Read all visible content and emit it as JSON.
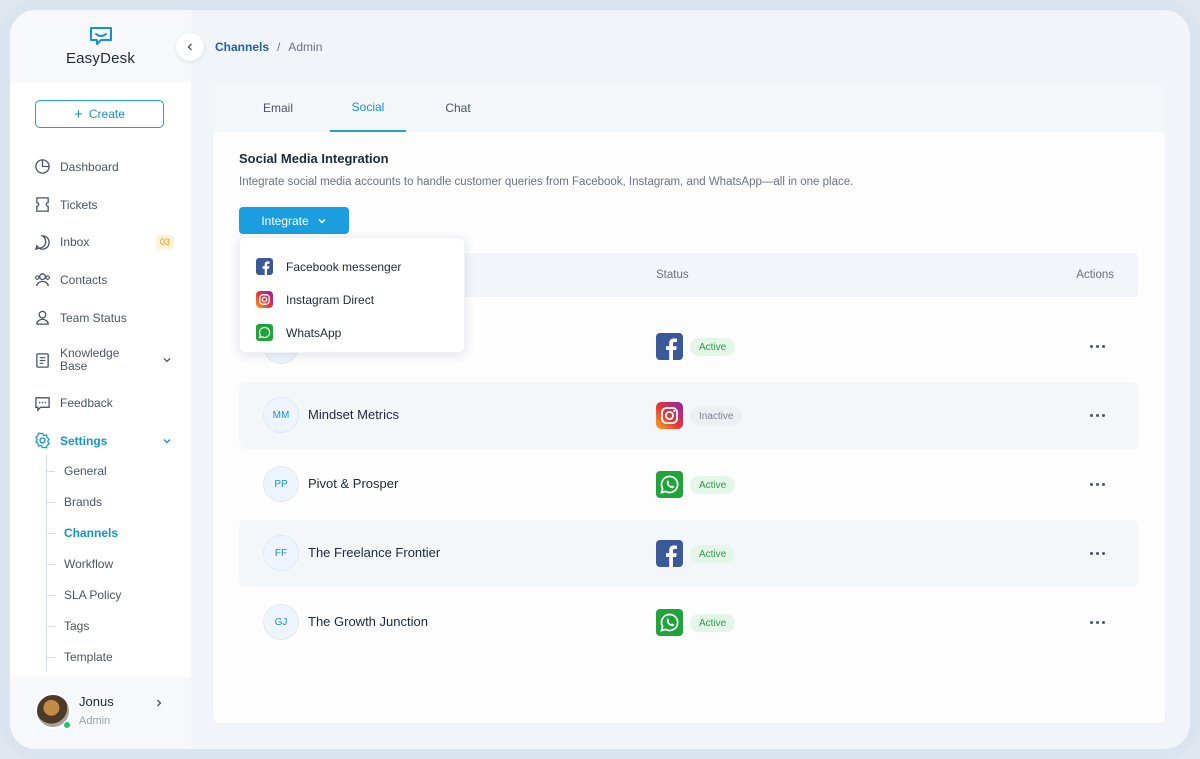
{
  "app": {
    "name": "EasyDesk"
  },
  "sidebar": {
    "create_label": "Create",
    "items": [
      {
        "label": "Dashboard",
        "icon": "dashboard-icon"
      },
      {
        "label": "Tickets",
        "icon": "ticket-icon"
      },
      {
        "label": "Inbox",
        "icon": "inbox-icon",
        "badge": "03"
      },
      {
        "label": "Contacts",
        "icon": "contacts-icon"
      },
      {
        "label": "Team Status",
        "icon": "user-icon"
      },
      {
        "label": "Knowledge Base",
        "icon": "book-icon"
      },
      {
        "label": "Feedback",
        "icon": "feedback-icon"
      },
      {
        "label": "Settings",
        "icon": "gear-icon"
      }
    ],
    "settings_children": [
      "General",
      "Brands",
      "Channels",
      "Workflow",
      "SLA Policy",
      "Tags",
      "Template"
    ],
    "active_child": "Channels"
  },
  "user": {
    "name": "Jonus",
    "role": "Admin",
    "status_color": "#22c55e"
  },
  "breadcrumb": {
    "parent": "Channels",
    "separator": "/",
    "current": "Admin"
  },
  "tabs": [
    {
      "label": "Email"
    },
    {
      "label": "Social",
      "active": true
    },
    {
      "label": "Chat"
    }
  ],
  "section": {
    "title": "Social Media Integration",
    "description": "Integrate social media accounts to handle customer queries from Facebook, Instagram, and WhatsApp—all in one place."
  },
  "integrate": {
    "label": "Integrate",
    "options": [
      {
        "label": "Facebook messenger",
        "icon": "facebook-icon"
      },
      {
        "label": "Instagram Direct",
        "icon": "instagram-icon"
      },
      {
        "label": "WhatsApp",
        "icon": "whatsapp-icon"
      }
    ]
  },
  "table": {
    "columns": {
      "status": "Status",
      "actions": "Actions"
    },
    "rows": [
      {
        "initials": "",
        "name": "",
        "channel": "facebook-icon",
        "status": "Active"
      },
      {
        "initials": "MM",
        "name": "Mindset Metrics",
        "channel": "instagram-icon",
        "status": "Inactive"
      },
      {
        "initials": "PP",
        "name": "Pivot & Prosper",
        "channel": "whatsapp-icon",
        "status": "Active"
      },
      {
        "initials": "FF",
        "name": "The Freelance Frontier",
        "channel": "facebook-icon",
        "status": "Active"
      },
      {
        "initials": "GJ",
        "name": "The Growth Junction",
        "channel": "whatsapp-icon",
        "status": "Active"
      }
    ]
  },
  "colors": {
    "accent": "#1a9ee0",
    "active": "#2f9b52",
    "inactive": "#7b8493",
    "breadcrumb_link": "#1f5fa8"
  }
}
